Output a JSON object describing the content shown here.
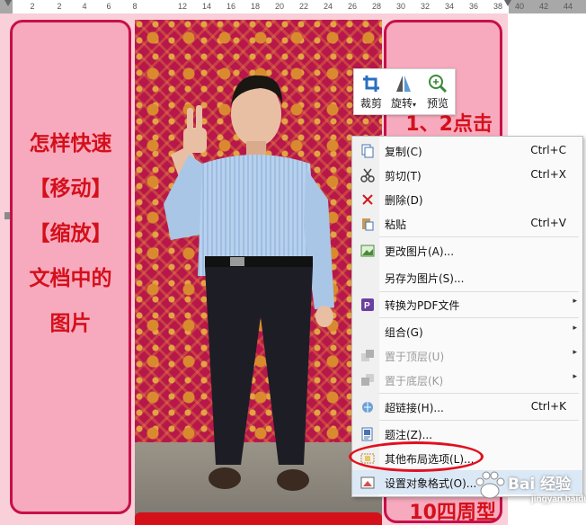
{
  "ruler": {
    "ticks": [
      "2",
      "",
      "2",
      "4",
      "6",
      "8",
      "",
      "12",
      "14",
      "16",
      "18",
      "20",
      "22",
      "24",
      "26",
      "28",
      "30",
      "32",
      "34",
      "36",
      "38",
      "40",
      "42",
      "44"
    ]
  },
  "left_panel": {
    "lines": [
      "怎样快速",
      "【移动】",
      "【缩放】",
      "文档中的",
      "图片"
    ]
  },
  "right_panel": {
    "top_text": "1、2点击",
    "bottom_text": "10四周型"
  },
  "mini_toolbar": {
    "crop_label": "裁剪",
    "rotate_label": "旋转",
    "preview_label": "预览"
  },
  "context_menu": {
    "items": [
      {
        "label": "复制(C)",
        "shortcut": "Ctrl+C",
        "icon": "copy-icon"
      },
      {
        "label": "剪切(T)",
        "shortcut": "Ctrl+X",
        "icon": "scissors-icon"
      },
      {
        "label": "删除(D)",
        "shortcut": "",
        "icon": "delete-x-icon"
      },
      {
        "label": "粘贴",
        "shortcut": "Ctrl+V",
        "icon": "paste-icon"
      },
      {
        "label": "更改图片(A)...",
        "shortcut": "",
        "icon": "change-picture-icon"
      },
      {
        "label": "另存为图片(S)...",
        "shortcut": "",
        "icon": ""
      },
      {
        "label": "转换为PDF文件",
        "shortcut": "",
        "icon": "pdf-icon"
      },
      {
        "label": "组合(G)",
        "shortcut": "",
        "icon": ""
      },
      {
        "label": "置于顶层(U)",
        "shortcut": "",
        "icon": "bring-to-front-icon"
      },
      {
        "label": "置于底层(K)",
        "shortcut": "",
        "icon": "send-to-back-icon"
      },
      {
        "label": "超链接(H)...",
        "shortcut": "Ctrl+K",
        "icon": "hyperlink-icon"
      },
      {
        "label": "题注(Z)...",
        "shortcut": "",
        "icon": "caption-icon"
      },
      {
        "label": "其他布局选项(L)...",
        "shortcut": "",
        "icon": "layout-options-icon"
      },
      {
        "label": "设置对象格式(O)...",
        "shortcut": "",
        "icon": "format-object-icon"
      }
    ]
  },
  "watermark": {
    "text": "Bai 经验",
    "sub": "jingyan.baidu.com"
  },
  "colors": {
    "accent_red": "#d4101b",
    "panel_pink": "#f7a9bd",
    "menu_highlight": "#dbe8f6"
  }
}
